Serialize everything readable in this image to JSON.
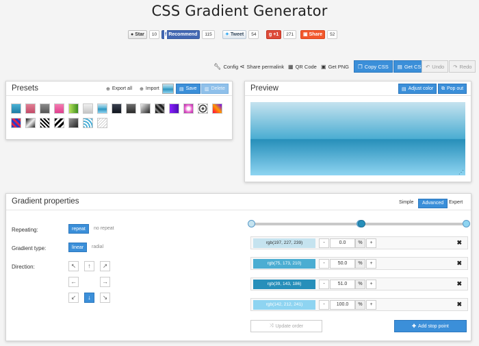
{
  "title": "CSS Gradient Generator",
  "social": {
    "github": {
      "label": "Star",
      "count": "10"
    },
    "facebook": {
      "label": "Recommend",
      "count": "115"
    },
    "twitter": {
      "label": "Tweet",
      "count": "54"
    },
    "gplus": {
      "label": "+1",
      "count": "271"
    },
    "share": {
      "label": "Share",
      "count": "52"
    }
  },
  "toolbar": {
    "config": "Config",
    "share_permalink": "Share permalink",
    "qr_code": "QR Code",
    "get_png": "Get PNG",
    "copy_css": "Copy CSS",
    "get_css": "Get CSS",
    "undo": "Undo",
    "redo": "Redo"
  },
  "presets": {
    "title": "Presets",
    "export_all": "Export all",
    "import": "Import",
    "save": "Save",
    "delete": "Delete"
  },
  "preview": {
    "title": "Preview",
    "adjust_color": "Adjust color",
    "pop_out": "Pop out"
  },
  "gradient_properties": {
    "title": "Gradient properties",
    "modes": [
      "Simple",
      "Advanced",
      "Expert"
    ],
    "active_mode": "Advanced",
    "repeating_label": "Repeating:",
    "repeat": "repeat",
    "no_repeat": "no repeat",
    "gradient_type_label": "Gradient type:",
    "linear": "linear",
    "radial": "radial",
    "direction_label": "Direction:"
  },
  "stops": [
    {
      "color": "rgb(197, 227, 239)",
      "hex": "#c5e3ef",
      "position": "0.0",
      "text_color": "#333"
    },
    {
      "color": "rgb(75, 173, 210)",
      "hex": "#4badd2",
      "position": "50.0",
      "text_color": "#ffffff"
    },
    {
      "color": "rgb(39, 143, 186)",
      "hex": "#278fba",
      "position": "51.0",
      "text_color": "#ffffff"
    },
    {
      "color": "rgb(142, 212, 241)",
      "hex": "#8ed4f1",
      "position": "100.0",
      "text_color": "#ffffff"
    }
  ],
  "stop_controls": {
    "minus": "-",
    "plus": "+",
    "percent": "%"
  },
  "update_order": "Update order",
  "add_stop_point": "Add stop point",
  "accent_color": "#3b8fd9"
}
